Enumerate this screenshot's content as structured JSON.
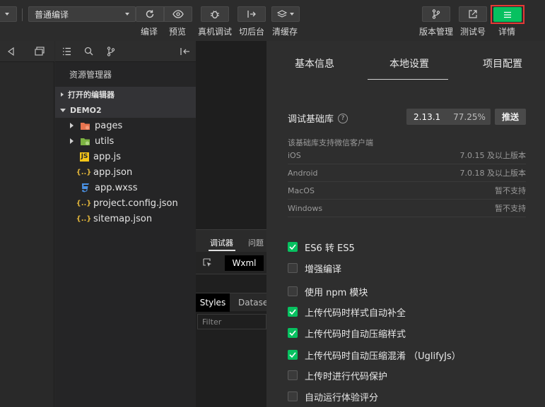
{
  "toolbar": {
    "compile_mode": "普通编译",
    "buttons": {
      "compile": "编译",
      "preview": "预览",
      "remote_debug": "真机调试",
      "background": "切后台",
      "clear_cache": "清缓存",
      "version": "版本管理",
      "test_account": "测试号",
      "details": "详情"
    },
    "accent": "#07c160",
    "highlight": "#e53935"
  },
  "explorer": {
    "title": "资源管理器",
    "open_editors": "打开的编辑器",
    "project": "DEMO2",
    "files": [
      {
        "name": "pages",
        "icon": "folder-pages-icon"
      },
      {
        "name": "utils",
        "icon": "folder-utils-icon"
      },
      {
        "name": "app.js",
        "icon": "js-file-icon"
      },
      {
        "name": "app.json",
        "icon": "json-file-icon"
      },
      {
        "name": "app.wxss",
        "icon": "css-file-icon"
      },
      {
        "name": "project.config.json",
        "icon": "json-file-icon"
      },
      {
        "name": "sitemap.json",
        "icon": "json-file-icon"
      }
    ]
  },
  "debugger": {
    "tab_debugger": "调试器",
    "tab_issues": "问题",
    "wxml": "Wxml",
    "styles": "Styles",
    "dataset": "Dataset",
    "filter_placeholder": "Filter"
  },
  "details": {
    "tabs": [
      "基本信息",
      "本地设置",
      "项目配置"
    ],
    "active_tab": "本地设置",
    "base_lib_label": "调试基础库",
    "base_lib_version": "2.13.1",
    "base_lib_percent": "77.25%",
    "push_button": "推送",
    "support_note": "该基础库支持微信客户端",
    "platforms": [
      {
        "name": "iOS",
        "value": "7.0.15 及以上版本"
      },
      {
        "name": "Android",
        "value": "7.0.18 及以上版本"
      },
      {
        "name": "MacOS",
        "value": "暂不支持"
      },
      {
        "name": "Windows",
        "value": "暂不支持"
      }
    ],
    "settings": [
      {
        "label": "ES6 转 ES5",
        "checked": true
      },
      {
        "label": "增强编译",
        "checked": false
      },
      {
        "label": "使用 npm 模块",
        "checked": false
      },
      {
        "label": "上传代码时样式自动补全",
        "checked": true
      },
      {
        "label": "上传代码时自动压缩样式",
        "checked": true
      },
      {
        "label": "上传代码时自动压缩混淆 （UglifyJs）",
        "checked": true
      },
      {
        "label": "上传时进行代码保护",
        "checked": false
      },
      {
        "label": "自动运行体验评分",
        "checked": false
      }
    ]
  }
}
